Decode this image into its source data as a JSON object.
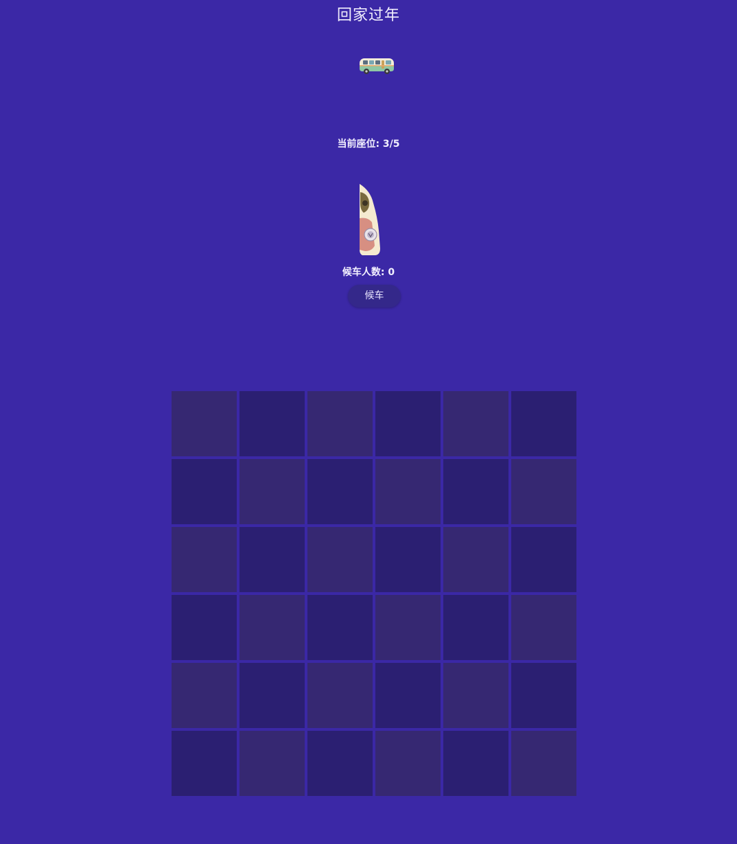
{
  "game": {
    "title": "回家过年",
    "seat_status": "当前座位: 3/5",
    "waiting_count": "候车人数: 0",
    "wait_button_label": "候车"
  },
  "sprites": {
    "bus": "bus-icon",
    "passenger": "passenger-icon"
  },
  "board": {
    "rows": 6,
    "cols": 6,
    "colors": {
      "light_cell": "#362872",
      "dark_cell": "#2b1f72",
      "background": "#3b28a6"
    }
  }
}
